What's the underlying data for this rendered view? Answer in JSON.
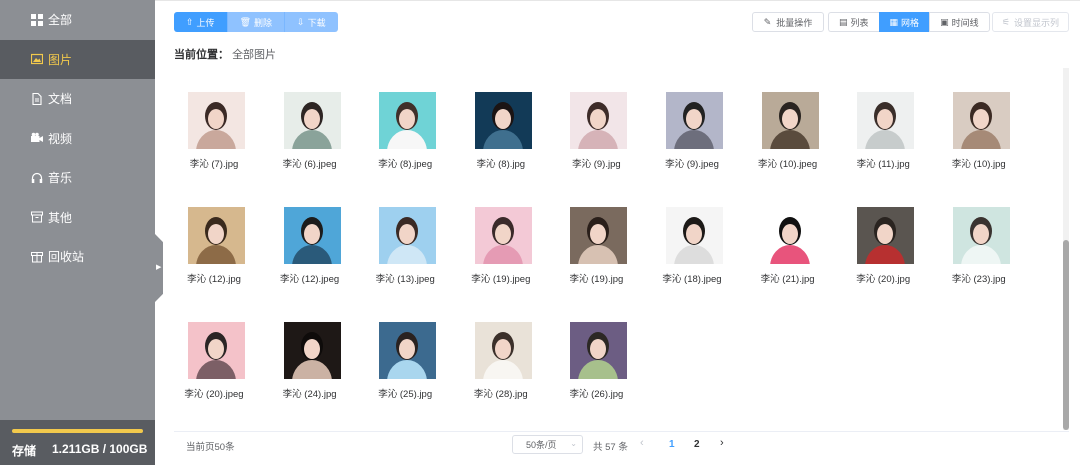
{
  "sidebar": {
    "items": [
      {
        "label": "全部",
        "icon": "grid-icon",
        "active": false
      },
      {
        "label": "图片",
        "icon": "image-icon",
        "active": true
      },
      {
        "label": "文档",
        "icon": "document-icon",
        "active": false
      },
      {
        "label": "视频",
        "icon": "video-icon",
        "active": false
      },
      {
        "label": "音乐",
        "icon": "headphones-icon",
        "active": false
      },
      {
        "label": "其他",
        "icon": "box-icon",
        "active": false
      },
      {
        "label": "回收站",
        "icon": "recycle-bin-icon",
        "active": false
      }
    ],
    "storage": {
      "label": "存储",
      "value": "1.211GB / 100GB",
      "used_fraction": 1.0
    }
  },
  "toolbar": {
    "upload": "上传",
    "delete": "删除",
    "download": "下载",
    "batch": "批量操作",
    "views": [
      {
        "label": "列表",
        "icon": "list-icon",
        "active": false
      },
      {
        "label": "网格",
        "icon": "grid-view-icon",
        "active": true
      },
      {
        "label": "时间线",
        "icon": "calendar-icon",
        "active": false
      }
    ],
    "settings": "设置显示列"
  },
  "location": {
    "label": "当前位置：",
    "path": "全部图片"
  },
  "files": [
    {
      "name": "李沁 (7).jpg"
    },
    {
      "name": "李沁 (6).jpeg"
    },
    {
      "name": "李沁 (8).jpeg"
    },
    {
      "name": "李沁 (8).jpg"
    },
    {
      "name": "李沁 (9).jpg"
    },
    {
      "name": "李沁 (9).jpeg"
    },
    {
      "name": "李沁 (10).jpeg"
    },
    {
      "name": "李沁 (11).jpg"
    },
    {
      "name": "李沁 (10).jpg"
    },
    {
      "name": "李沁 (12).jpg"
    },
    {
      "name": "李沁 (12).jpeg"
    },
    {
      "name": "李沁 (13).jpeg"
    },
    {
      "name": "李沁 (19).jpeg"
    },
    {
      "name": "李沁 (19).jpg"
    },
    {
      "name": "李沁 (18).jpeg"
    },
    {
      "name": "李沁 (21).jpg"
    },
    {
      "name": "李沁 (20).jpg"
    },
    {
      "name": "李沁 (23).jpg"
    },
    {
      "name": "李沁 (20).jpeg"
    },
    {
      "name": "李沁 (24).jpg"
    },
    {
      "name": "李沁 (25).jpg"
    },
    {
      "name": "李沁 (28).jpg"
    },
    {
      "name": "李沁 (26).jpg"
    }
  ],
  "pagination": {
    "current_count": "当前页50条",
    "page_size": "50条/页",
    "total": "共 57 条",
    "pages": [
      "1",
      "2"
    ],
    "current_page": "1"
  },
  "colors": {
    "primary": "#409eff",
    "sidebar_bg": "#8c8f94",
    "sidebar_active_bg": "#595c61",
    "sidebar_active_text": "#f2c94c"
  }
}
